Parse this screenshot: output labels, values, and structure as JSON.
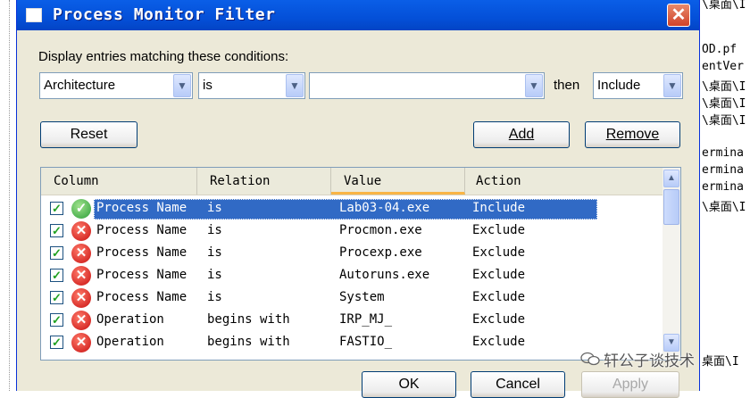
{
  "window": {
    "title": "Process Monitor Filter",
    "close_glyph": "✕"
  },
  "prompt": "Display entries matching these conditions:",
  "filter": {
    "column": "Architecture",
    "relation": "is",
    "value": "",
    "then_label": "then",
    "action": "Include"
  },
  "buttons": {
    "reset": "Reset",
    "add": "Add",
    "remove": "Remove",
    "ok": "OK",
    "cancel": "Cancel",
    "apply": "Apply"
  },
  "list": {
    "headers": [
      "Column",
      "Relation",
      "Value",
      "Action"
    ],
    "rows": [
      {
        "column": "Process Name",
        "relation": "is",
        "value": "Lab03-04.exe",
        "action": "Include",
        "status": "include",
        "checked": true,
        "selected": true
      },
      {
        "column": "Process Name",
        "relation": "is",
        "value": "Procmon.exe",
        "action": "Exclude",
        "status": "exclude",
        "checked": true,
        "selected": false
      },
      {
        "column": "Process Name",
        "relation": "is",
        "value": "Procexp.exe",
        "action": "Exclude",
        "status": "exclude",
        "checked": true,
        "selected": false
      },
      {
        "column": "Process Name",
        "relation": "is",
        "value": "Autoruns.exe",
        "action": "Exclude",
        "status": "exclude",
        "checked": true,
        "selected": false
      },
      {
        "column": "Process Name",
        "relation": "is",
        "value": "System",
        "action": "Exclude",
        "status": "exclude",
        "checked": true,
        "selected": false
      },
      {
        "column": "Operation",
        "relation": "begins with",
        "value": "IRP_MJ_",
        "action": "Exclude",
        "status": "exclude",
        "checked": true,
        "selected": false
      },
      {
        "column": "Operation",
        "relation": "begins with",
        "value": "FASTIO_",
        "action": "Exclude",
        "status": "exclude",
        "checked": true,
        "selected": false
      }
    ]
  },
  "background_text": [
    "\\桌面\\I",
    "OD.pf",
    "entVer",
    "\\桌面\\I",
    "\\桌面\\I",
    "\\桌面\\I",
    "",
    "ermina",
    "ermina",
    "ermina",
    "\\桌面\\I"
  ],
  "background_text_bottom": "桌面\\I",
  "watermark": "轩公子谈技术",
  "icons": {
    "include": "check-circle-icon",
    "exclude": "x-circle-icon",
    "dropdown": "chevron-down-icon"
  },
  "colors": {
    "titlebar": "#0450d8",
    "selection": "#316ac5",
    "include_icon": "#2d9e3a",
    "exclude_icon": "#c80f0f",
    "dialog_bg": "#ece9d8"
  }
}
